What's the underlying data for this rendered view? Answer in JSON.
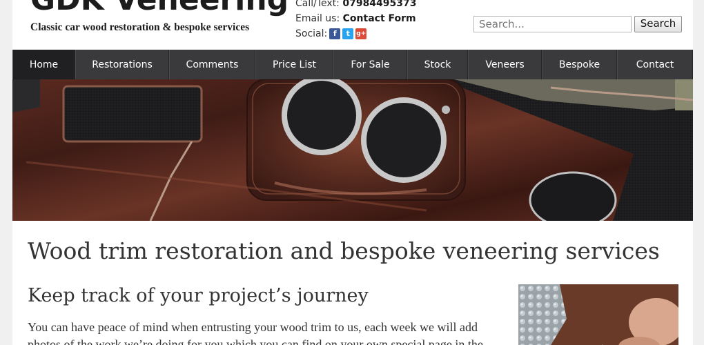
{
  "header": {
    "logo": "GDK Veneering",
    "tagline": "Classic car wood restoration & bespoke services",
    "call_label": "Call/Text:",
    "call_number": "07984495373",
    "email_label": "Email us:",
    "email_link": "Contact Form",
    "social_label": "Social:",
    "social_icons": [
      "facebook-icon",
      "twitter-icon",
      "google-plus-icon"
    ]
  },
  "search": {
    "placeholder": "Search...",
    "button_label": "Search"
  },
  "nav": {
    "items": [
      {
        "label": "Home",
        "active": true
      },
      {
        "label": "Restorations"
      },
      {
        "label": "Comments"
      },
      {
        "label": "Price List"
      },
      {
        "label": "For Sale"
      },
      {
        "label": "Stock"
      },
      {
        "label": "Veneers"
      },
      {
        "label": "Bespoke"
      },
      {
        "label": "Contact"
      }
    ]
  },
  "main": {
    "title": "Wood trim restoration and bespoke veneering services",
    "subtitle": "Keep track of your project’s journey",
    "paragraph": "You can have peace of mind when entrusting your wood trim to us, each week we will add photos of the work we’re doing for you which you can find on your own special page in the"
  },
  "colors": {
    "nav_bg": "#3a3a3c",
    "nav_active": "#202022",
    "page_bg": "#f0f0f0",
    "facebook": "#3b5998",
    "twitter": "#2aa3ef",
    "google_plus": "#dd4b39"
  }
}
